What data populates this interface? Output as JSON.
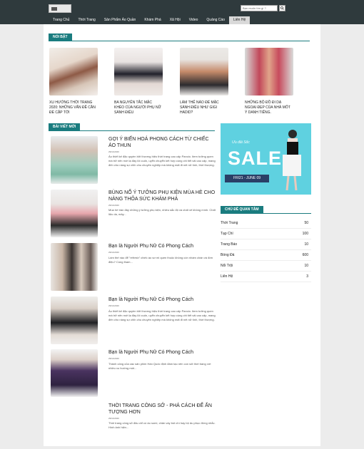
{
  "header": {
    "search_placeholder": "Bạn muốn tìm gì ?"
  },
  "nav": [
    "Trang Chủ",
    "Thời Trang",
    "Sản Phẩm Áo Quần",
    "Khám Phá",
    "Xã Hội",
    "Video",
    "Quảng Cáo",
    "Liên Hệ"
  ],
  "featured": {
    "heading": "NỔI BẬT",
    "items": [
      {
        "caption": "XU HƯỚNG THỜI TRANG 2020: NHỮNG VẤN ĐỀ CẦN ĐỂ CẬP TỚI"
      },
      {
        "caption": "BA NGUYÊN TẮC MẶC KHÉO CỦA NGƯỜI PHỤ NỮ SÀNH ĐIỆU"
      },
      {
        "caption": "LÀM THẾ NÀO ĐỂ MẶC SÀNH ĐIỆU NHƯ GIGI HADID?"
      },
      {
        "caption": "NHỮNG BỘ ĐỒ ĐI DẠ NGOẠI ĐẸP CỦA NHÀ MỐT Ý DANH TIẾNG."
      }
    ]
  },
  "latest": {
    "heading": "BÀI VIẾT MỚI",
    "posts": [
      {
        "title": "GỢI Ý BIẾN HOÁ PHONG CÁCH TỪ CHIẾC ÁO THUN",
        "date": "29/11/2020",
        "desc": "Áo thiết kế đặc quyền bởi thương hiệu thời trang cao cấp Pancio. Item tưởng quen mà trở nên mới lạ đầy lôi cuốn, uyển chuyển kết hợp cùng chi tiết vải cao cấp, mang đến cho nàng sự chỉn chu chuyên nghiệp mà không mất đi nét nữ tính, thời thượng."
      },
      {
        "title": "BÙNG NỔ Ý TƯỞNG PHỤ KIỆN MÙA HÈ CHO NÀNG THỎA SỨC KHÁM PHÁ",
        "date": "29/11/2020",
        "desc": "Mùa hè tràn đầy những ý tưởng phụ kiện, nhiều sắc độ và chất xế không mình. Chất liệu da, mây..."
      },
      {
        "title": "Bạn là Người Phụ Nữ Có Phong Cách",
        "date": "29/11/2020",
        "desc": "Làm thế nào để \"refresh\" chiếc áo sơ mi quen thuộc không còn nhàm chán và đơn điệu? Cùng tham..."
      },
      {
        "title": "Bạn là Người Phụ Nữ Có Phong Cách",
        "date": "29/11/2020",
        "desc": "Áo thiết kế đặc quyền bởi thương hiệu thời trang cao cấp Pancio. Item tưởng quen mà trở nên mới lạ đầy lôi cuốn, uyển chuyển kết hợp cùng chi tiết vải cao cấp, mang đến cho nàng sự chỉn chu chuyên nghiệp mà không mất đi nét nữ tính, thời thượng."
      },
      {
        "title": "Bạn là Người Phụ Nữ Có Phong Cách",
        "date": "29/11/2020",
        "desc": "Thành công của các sản phim Hàn Quốc định đám tạo nên con sốt thời trang với nhiều xu hướng mới..."
      },
      {
        "title": "THỜI TRANG CÔNG SỞ - PHÁ CÁCH ĐỂ ẤN TƯỢNG HƠN",
        "date": "29/11/2020",
        "desc": "Thời trang công sở đâu chỉ có áo somi, chân váy bút chì hay bộ âu phục đứng nhắc. Hình ảnh hiện..."
      }
    ]
  },
  "banner": {
    "word": "SALE",
    "script": "Ưu đãi Sốc",
    "dates": "FRI21 - JUNE 09"
  },
  "topics": {
    "heading": "CHỦ ĐỀ QUAN TÂM",
    "items": [
      {
        "name": "Thời Trang",
        "count": "50"
      },
      {
        "name": "Tạp Chí",
        "count": "100"
      },
      {
        "name": "Trang Báo",
        "count": "10"
      },
      {
        "name": "Bóng Đá",
        "count": "600"
      },
      {
        "name": "Nổi Trội",
        "count": "10"
      },
      {
        "name": "Liên Hệ",
        "count": "3"
      }
    ]
  },
  "colors": {
    "header": "#2f3a3d",
    "accent": "#1a7c7f",
    "banner": "#5fd1e0"
  }
}
